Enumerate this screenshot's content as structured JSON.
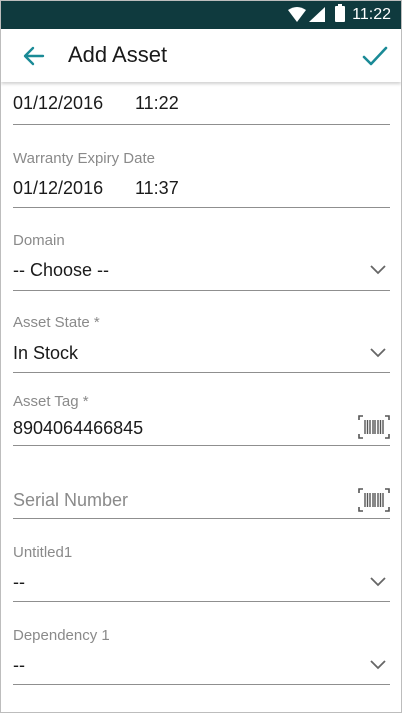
{
  "status_bar": {
    "time": "11:22"
  },
  "app_bar": {
    "title": "Add Asset"
  },
  "form": {
    "date_field": {
      "date": "01/12/2016",
      "time": "11:22"
    },
    "warranty_expiry": {
      "label": "Warranty Expiry Date",
      "date": "01/12/2016",
      "time": "11:37"
    },
    "domain": {
      "label": "Domain",
      "value": "-- Choose --"
    },
    "asset_state": {
      "label": "Asset State *",
      "value": "In Stock"
    },
    "asset_tag": {
      "label": "Asset Tag *",
      "value": "8904064466845"
    },
    "serial_number": {
      "placeholder": "Serial Number"
    },
    "untitled1": {
      "label": "Untitled1",
      "value": "--"
    },
    "dependency1": {
      "label": "Dependency 1",
      "value": "--"
    }
  },
  "colors": {
    "status_bar": "#0f3a3e",
    "accent": "#1a8a96",
    "divider": "#8f8f8f",
    "label": "#8a8a8a"
  },
  "icons": {
    "back": "arrow-left-icon",
    "done": "checkmark-icon",
    "dropdown": "chevron-down-icon",
    "scan": "barcode-icon"
  }
}
